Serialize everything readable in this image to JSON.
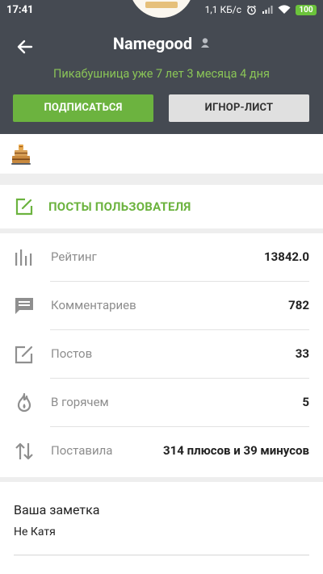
{
  "statusbar": {
    "time": "17:41",
    "speed": "1,1 КБ/с",
    "battery": "100",
    "battery_color": "#6cc33b"
  },
  "header": {
    "username": "Namegood",
    "subtitle": "Пикабушница уже 7 лет 3 месяца 4 дня",
    "subscribe_label": "ПОДПИСАТЬСЯ",
    "ignore_label": "ИГНОР-ЛИСТ",
    "background": "#454a52",
    "accent": "#6cb33f"
  },
  "awards": {
    "items": [
      "award-cake-icon"
    ]
  },
  "posts": {
    "label": "ПОСТЫ ПОЛЬЗОВАТЕЛЯ"
  },
  "stats": [
    {
      "icon": "rating-bars-icon",
      "label": "Рейтинг",
      "value": "13842.0"
    },
    {
      "icon": "comments-icon",
      "label": "Комментариев",
      "value": "782"
    },
    {
      "icon": "edit-icon",
      "label": "Постов",
      "value": "33"
    },
    {
      "icon": "flame-icon",
      "label": "В горячем",
      "value": "5"
    },
    {
      "icon": "up-down-arrows-icon",
      "label": "Поставила",
      "value": "314 плюсов и 39 минусов"
    }
  ],
  "note": {
    "title": "Ваша заметка",
    "text": "Не Катя"
  }
}
